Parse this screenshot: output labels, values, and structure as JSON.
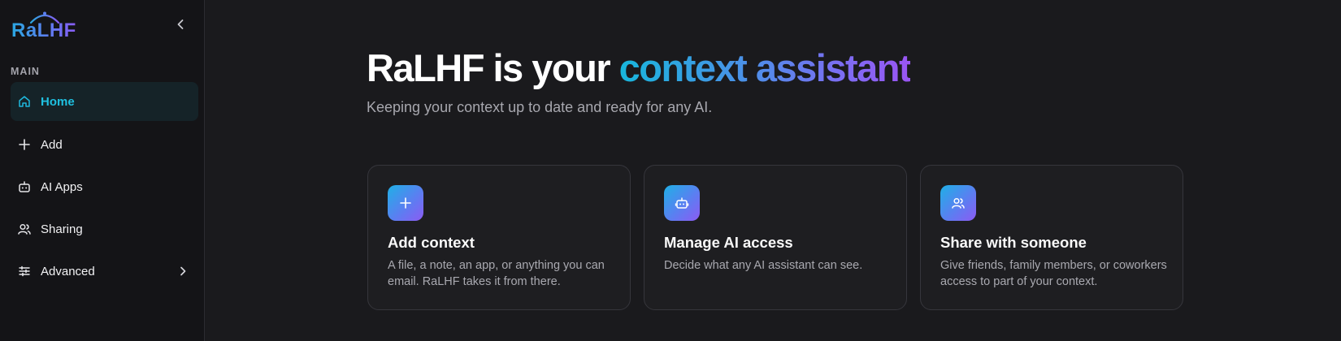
{
  "app": {
    "logo_text": "RaLHF"
  },
  "sidebar": {
    "section_label": "MAIN",
    "items": [
      {
        "label": "Home",
        "icon": "home-icon",
        "active": true
      },
      {
        "label": "Add",
        "icon": "plus-icon"
      },
      {
        "label": "AI Apps",
        "icon": "bot-icon"
      },
      {
        "label": "Sharing",
        "icon": "users-icon"
      },
      {
        "label": "Advanced",
        "icon": "sliders-icon",
        "has_submenu": true
      }
    ]
  },
  "hero": {
    "title_plain": "RaLHF is your ",
    "title_highlight": "context assistant",
    "subtitle": "Keeping your context up to date and ready for any AI."
  },
  "cards": [
    {
      "title": "Add context",
      "description": "A file, a note, an app, or anything you can email. RaLHF takes it from there.",
      "icon": "plus-icon"
    },
    {
      "title": "Manage AI access",
      "description": "Decide what any AI assistant can see.",
      "icon": "bot-icon"
    },
    {
      "title": "Share with someone",
      "description": "Give friends, family members, or coworkers access to part of your context.",
      "icon": "users-icon"
    }
  ],
  "colors": {
    "background": "#1a1a1d",
    "sidebar_background": "#141417",
    "accent": "#1fc0e0",
    "gradient_start": "#18b6dc",
    "gradient_end": "#9a55f3"
  }
}
